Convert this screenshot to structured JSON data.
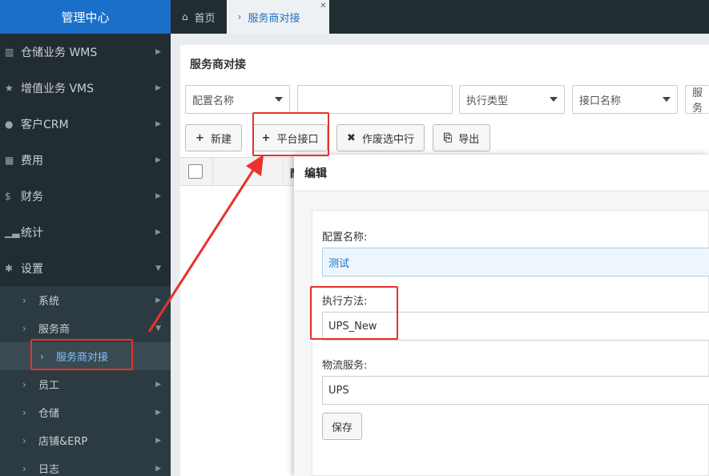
{
  "sidebar": {
    "brand": "管理中心",
    "items": [
      {
        "icon": "bank-icon",
        "label": "仓储业务 WMS"
      },
      {
        "icon": "star-icon",
        "label": "增值业务 VMS"
      },
      {
        "icon": "user-circle-icon",
        "label": "客户CRM"
      },
      {
        "icon": "grid-icon",
        "label": "费用"
      },
      {
        "icon": "dollar-icon",
        "label": "财务"
      },
      {
        "icon": "bar-chart-icon",
        "label": "统计"
      },
      {
        "icon": "gear-icon",
        "label": "设置"
      }
    ],
    "subitems": [
      {
        "label": "系统"
      },
      {
        "label": "服务商"
      },
      {
        "label": "服务商对接"
      },
      {
        "label": "员工"
      },
      {
        "label": "仓储"
      },
      {
        "label": "店铺&ERP"
      },
      {
        "label": "日志"
      }
    ]
  },
  "tabs": [
    {
      "icon": "home-icon",
      "label": "首页"
    },
    {
      "icon": "chevron-right-icon",
      "label": "服务商对接"
    }
  ],
  "page": {
    "title": "服务商对接",
    "filters": [
      "配置名称",
      "",
      "执行类型",
      "接口名称",
      "服务"
    ],
    "buttons": {
      "new": "新建",
      "platform": "平台接口",
      "void": "作废选中行",
      "export": "导出"
    },
    "grid_col": "配"
  },
  "modal": {
    "title": "编辑",
    "fields": [
      {
        "label": "配置名称:",
        "value": "测试"
      },
      {
        "label": "执行方法:",
        "value": "UPS_New"
      },
      {
        "label": "物流服务:",
        "value": "UPS"
      }
    ],
    "save": "保存"
  },
  "colors": {
    "sidebar": "#222d32",
    "brand": "#1a6fc8",
    "annotation": "#e8322b"
  }
}
